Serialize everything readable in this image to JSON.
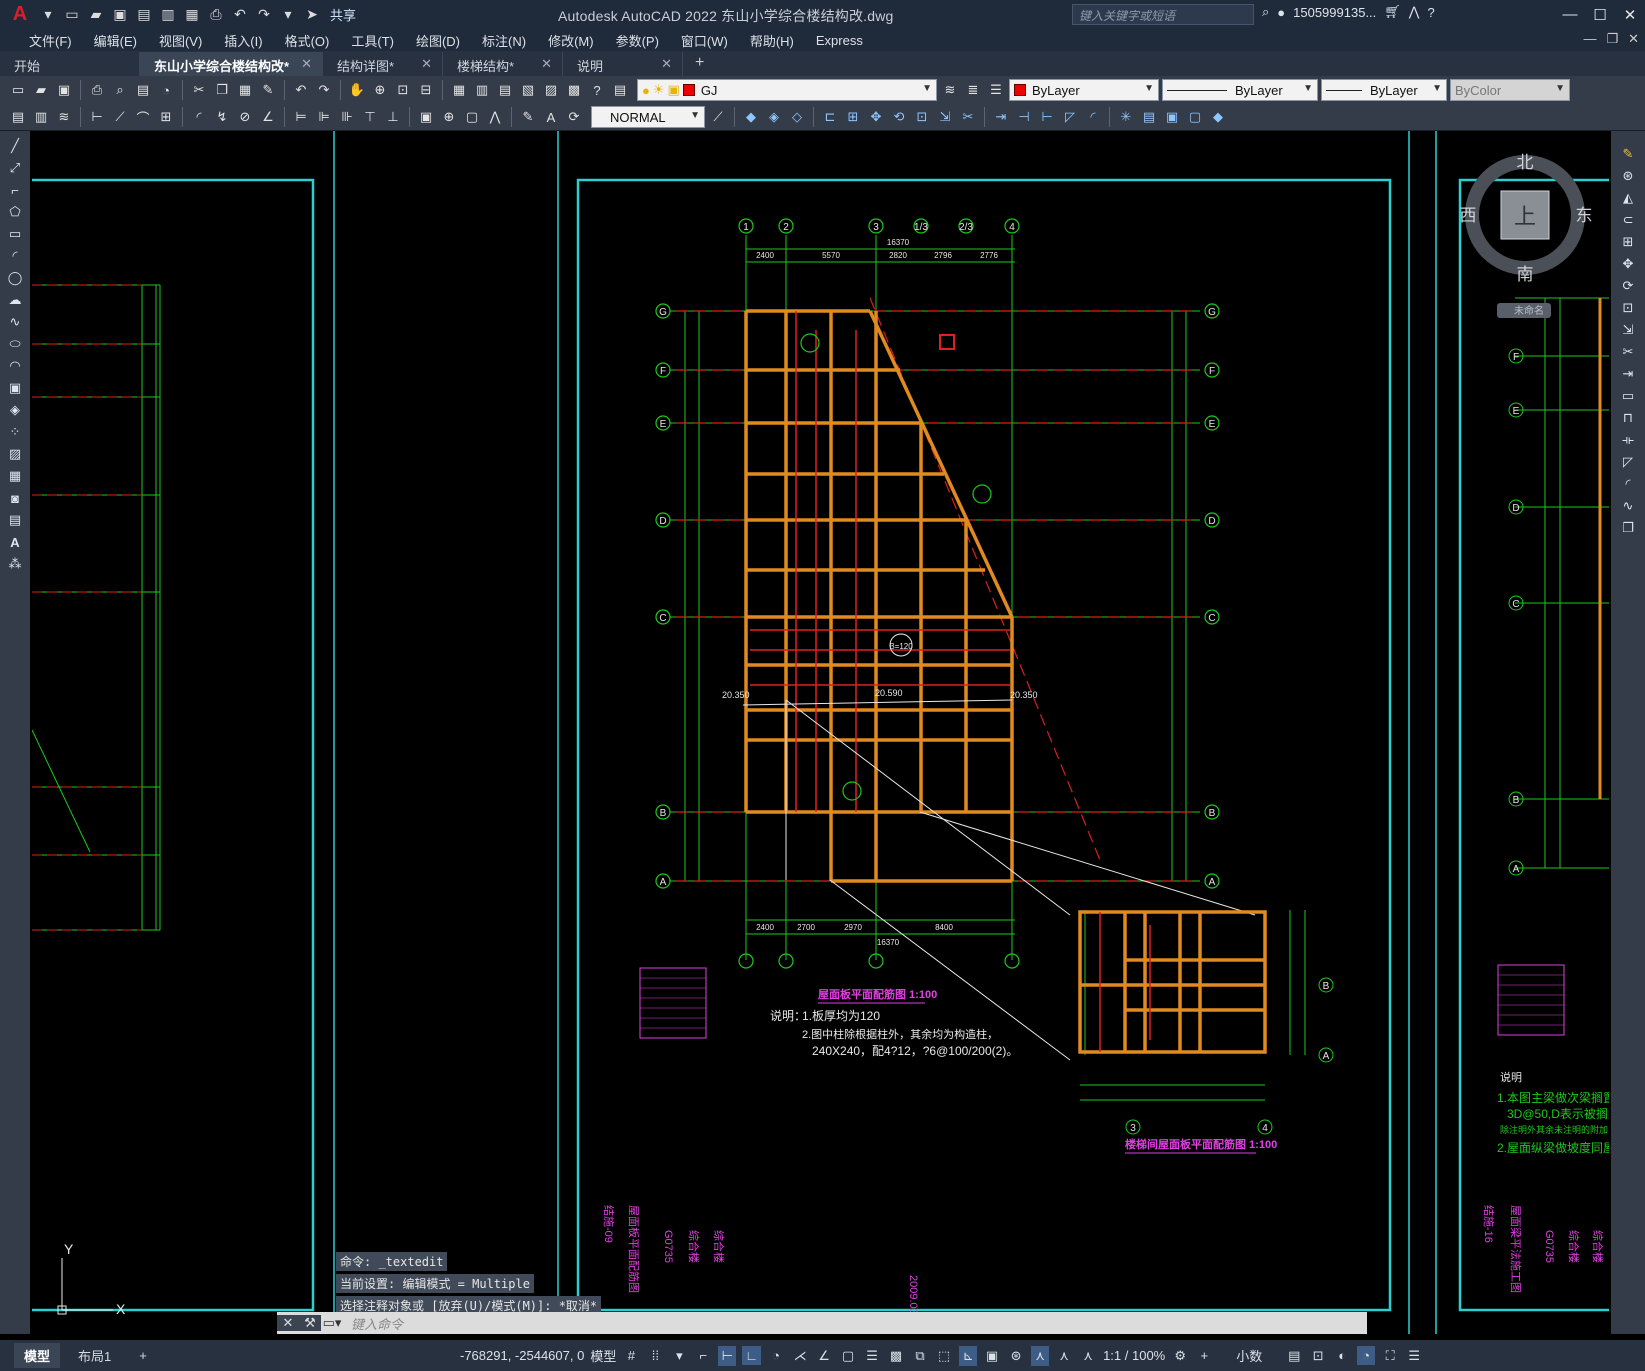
{
  "title": "Autodesk AutoCAD 2022    东山小学综合楼结构改.dwg",
  "share_label": "共享",
  "search_placeholder": "键入关键字或短语",
  "user_name": "1505999135...",
  "menus": [
    "文件(F)",
    "编辑(E)",
    "视图(V)",
    "插入(I)",
    "格式(O)",
    "工具(T)",
    "绘图(D)",
    "标注(N)",
    "修改(M)",
    "参数(P)",
    "窗口(W)",
    "帮助(H)",
    "Express"
  ],
  "tabs": [
    {
      "label": "开始",
      "active": false,
      "closable": false
    },
    {
      "label": "东山小学综合楼结构改*",
      "active": true,
      "closable": true
    },
    {
      "label": "结构详图*",
      "active": false,
      "closable": true
    },
    {
      "label": "楼梯结构*",
      "active": false,
      "closable": true
    },
    {
      "label": "说明",
      "active": false,
      "closable": true
    }
  ],
  "layer_value": "GJ",
  "color_value": "ByLayer",
  "linetype_value": "ByLayer",
  "lineweight_value": "ByLayer",
  "plotstyle_value": "ByColor",
  "dimstyle_value": "NORMAL",
  "viewcube": {
    "north": "北",
    "south": "南",
    "east": "东",
    "west": "西",
    "top": "上",
    "wcs": "未命名"
  },
  "command_history": [
    "命令: _textedit",
    "当前设置: 编辑模式 = Multiple",
    "选择注释对象或 [放弃(U)/模式(M)]: *取消*"
  ],
  "command_placeholder": "键入命令",
  "layout_tabs": [
    "模型",
    "布局1"
  ],
  "coordinates": "-768291, -2544607, 0",
  "model_label": "模型",
  "scale_label": "1:1 / 100%",
  "units_label": "小数",
  "drawing": {
    "plan1_title": "屋面板平面配筋图 1:100",
    "plan2_title": "楼梯间屋面板平面配筋图 1:100",
    "notes_title": "说明：",
    "notes": [
      "1.板厚均为120",
      "2.图中柱除根据柱外，其余均为构造柱，",
      "240X240，配4?12，?6@100/200(2)。"
    ],
    "right_notes_title": "说明",
    "right_notes": [
      "1.本图主梁做次梁搁置处",
      "3D@50,D表示被搁置处梁",
      "除注明外其余未注明的附加吊筋",
      "2.屋面纵梁做坡度同屋"
    ],
    "elev_labels": [
      "20.350",
      "20.590",
      "20.350"
    ],
    "axis_top": [
      "1",
      "2",
      "3",
      "1/3",
      "2/3",
      "4"
    ],
    "axis_side": [
      "G",
      "F",
      "E",
      "D",
      "C",
      "B",
      "A"
    ],
    "bottom_dims": [
      "2400",
      "2700",
      "2970",
      "8400",
      "16370"
    ],
    "top_dims": [
      "2400",
      "5570",
      "2820",
      "2796",
      "2776",
      "16370"
    ],
    "sheet_text": [
      "结施-09",
      "屋面板平面配筋图",
      "G0735",
      "综合楼",
      "综合楼"
    ],
    "sheet_text_right": [
      "结施-16",
      "屋面梁平法施工图"
    ],
    "date_text": "2009.03",
    "ucs_y": "Y",
    "ucs_x": "X",
    "marker": "B=120"
  }
}
